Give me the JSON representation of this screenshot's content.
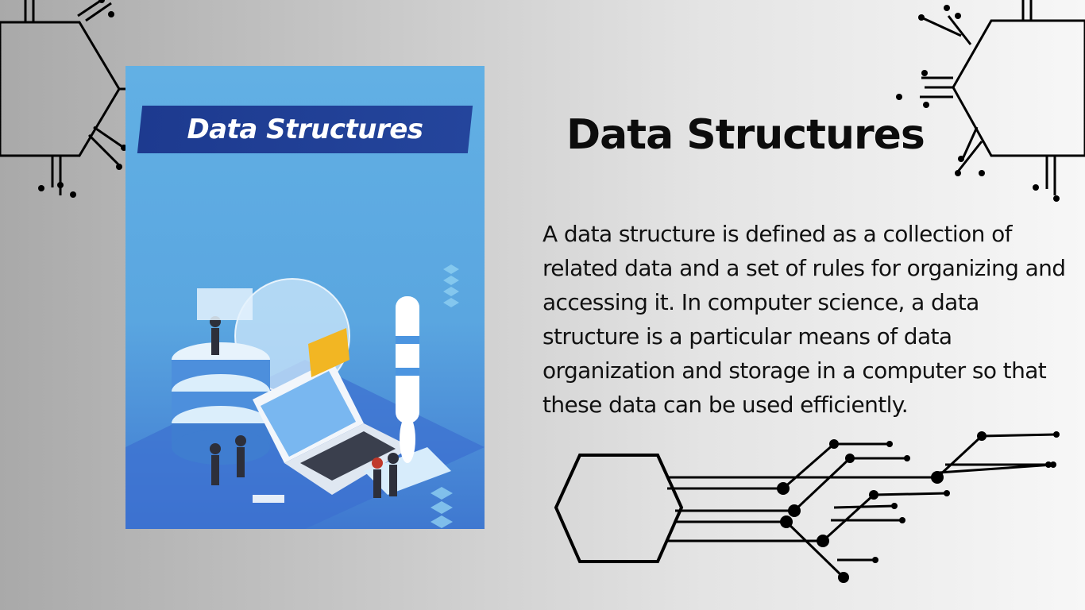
{
  "cover": {
    "title": "Data Structures"
  },
  "heading": "Data Structures",
  "description": "A data structure is defined as a collection of related data and a set of rules for organizing and accessing it. In computer science, a data structure is a particular means of data organization and storage in a computer so that these data can be used efficiently.",
  "colors": {
    "cover_background": "#5aa6e0",
    "cover_banner": "#1d3a8f",
    "text": "#0c0c0c",
    "circuit_lines": "#000000"
  },
  "icons": [
    "circuit-hexagon-icon"
  ]
}
